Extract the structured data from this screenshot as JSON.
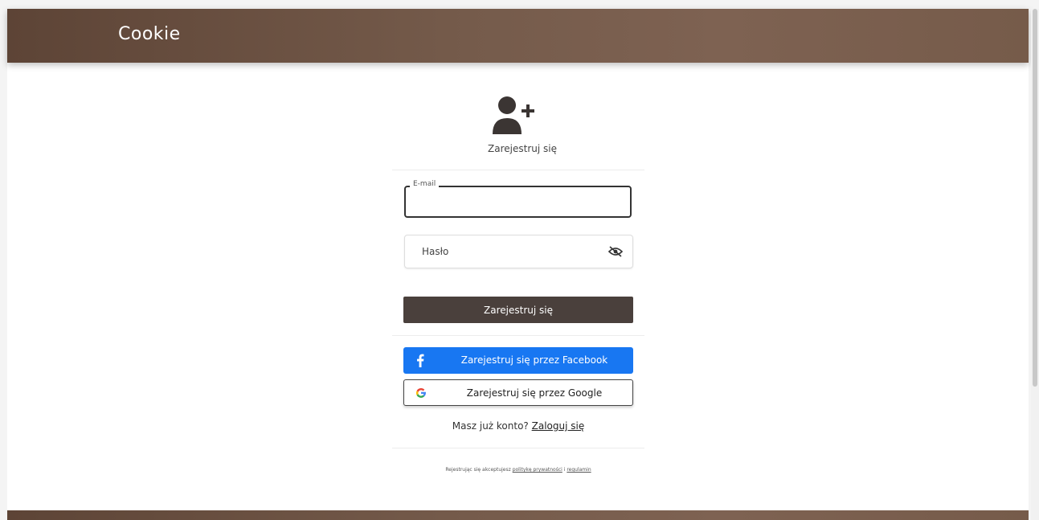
{
  "navbar": {
    "brand": "Cookie"
  },
  "register": {
    "title": "Zarejestruj się",
    "icon": "user-plus-icon",
    "email_legend": "E-mail",
    "email_value": "",
    "password_label": "Hasło",
    "submit_label": "Zarejestruj się",
    "facebook_label": "Zarejestruj się przez Facebook",
    "google_label": "Zarejestruj się przez Google",
    "have_account_text": "Masz już konto?",
    "login_link": "Zaloguj się",
    "terms_prefix": "Rejestrując się akceptujesz",
    "privacy_link": "politykę prywatności",
    "terms_and": "i",
    "rules_link": "regulamin"
  },
  "colors": {
    "navbar": "#755b4b",
    "submit": "#4a403c",
    "facebook": "#1877f2"
  }
}
